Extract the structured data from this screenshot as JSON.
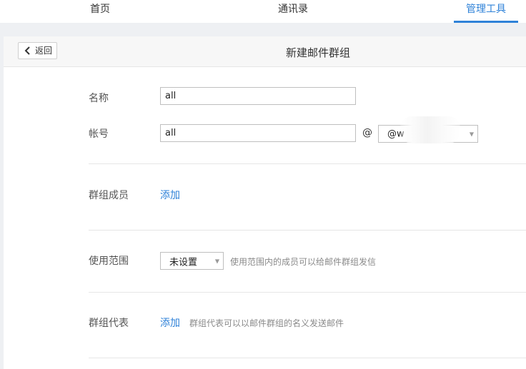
{
  "topnav": {
    "tabs": [
      {
        "label": "首页",
        "active": false
      },
      {
        "label": "通讯录",
        "active": false
      },
      {
        "label": "管理工具",
        "active": true
      }
    ],
    "accent_color": "#2f82d8"
  },
  "header": {
    "back_label": "返回",
    "back_icon": "chevron-left-icon",
    "title": "新建邮件群组"
  },
  "form": {
    "name": {
      "label": "名称",
      "value": "all"
    },
    "account": {
      "label": "帐号",
      "value": "all",
      "at": "@",
      "domain_selected": "@w"
    },
    "members": {
      "label": "群组成员",
      "action": "添加"
    },
    "scope": {
      "label": "使用范围",
      "selected": "未设置",
      "hint": "使用范围内的成员可以给邮件群组发信"
    },
    "representatives": {
      "label": "群组代表",
      "action": "添加",
      "hint": "群组代表可以以邮件群组的名义发送邮件"
    }
  }
}
